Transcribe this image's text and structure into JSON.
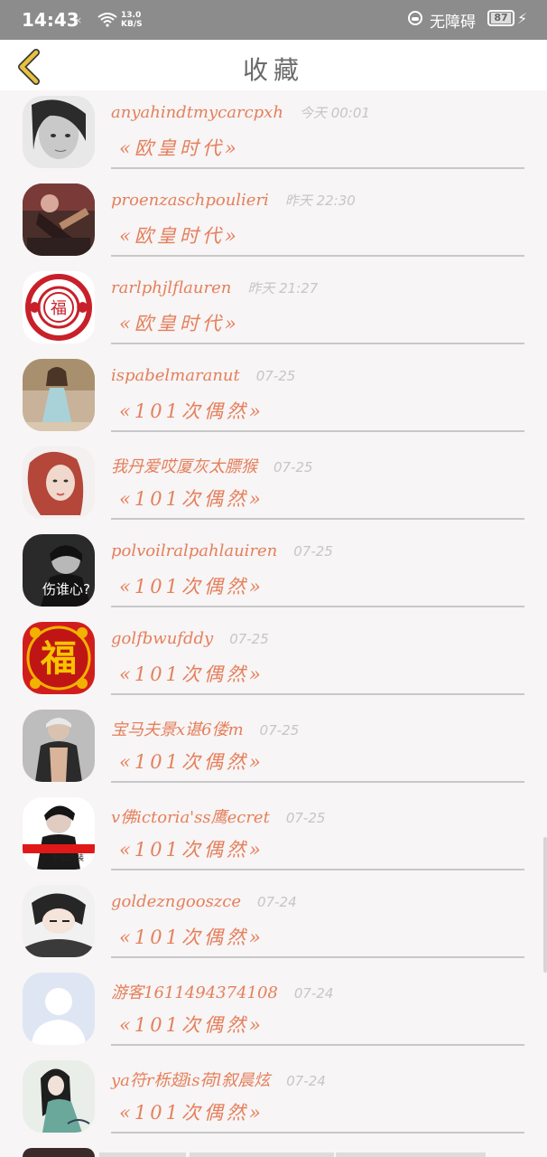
{
  "status_bar": {
    "time": "14:43",
    "signal": "×",
    "speed_value": "13.0",
    "speed_unit": "KB/S",
    "accessibility": "无障碍",
    "battery": "87"
  },
  "header": {
    "title": "收藏",
    "back_color": "#e8c23e"
  },
  "items": [
    {
      "name": "anyahindtmycarcpxh",
      "time": "今天 00:01",
      "book": "«欧皇时代»",
      "avatar": "bw-girl"
    },
    {
      "name": "proenzaschpoulieri",
      "time": "昨天 22:30",
      "book": "«欧皇时代»",
      "avatar": "guitar-girl"
    },
    {
      "name": "rarlphjlflauren",
      "time": "昨天 21:27",
      "book": "«欧皇时代»",
      "avatar": "fu-papercut"
    },
    {
      "name": "ispabelmaranut",
      "time": "07-25",
      "book": "«101次偶然»",
      "avatar": "dress-girl"
    },
    {
      "name": "我丹爱哎厦灰太膘猴",
      "time": "07-25",
      "book": "«101次偶然»",
      "avatar": "redhair-girl"
    },
    {
      "name": "polvoilralpahlauiren",
      "time": "07-25",
      "book": "«101次偶然»",
      "avatar": "dark-boy",
      "avatar_text": "伤谁心?"
    },
    {
      "name": "golfbwufddy",
      "time": "07-25",
      "book": "«101次偶然»",
      "avatar": "fu-red"
    },
    {
      "name": "宝马夫景x谌6偻m",
      "time": "07-25",
      "book": "«101次偶然»",
      "avatar": "shirtless-man"
    },
    {
      "name": "v佛ictoria'ss鹰ecret",
      "time": "07-25",
      "book": "«101次偶然»",
      "avatar": "boy-redbar"
    },
    {
      "name": "goldezngooszce",
      "time": "07-24",
      "book": "«101次偶然»",
      "avatar": "anime-boy"
    },
    {
      "name": "游客1611494374108",
      "time": "07-24",
      "book": "«101次偶然»",
      "avatar": "default"
    },
    {
      "name": "ya符r栎翅is荷l叙晨炫",
      "time": "07-24",
      "book": "«101次偶然»",
      "avatar": "ink-lady"
    }
  ],
  "colors": {
    "accent": "#e57f5c",
    "muted": "#c6c6c6",
    "background": "#f7f5f5"
  }
}
